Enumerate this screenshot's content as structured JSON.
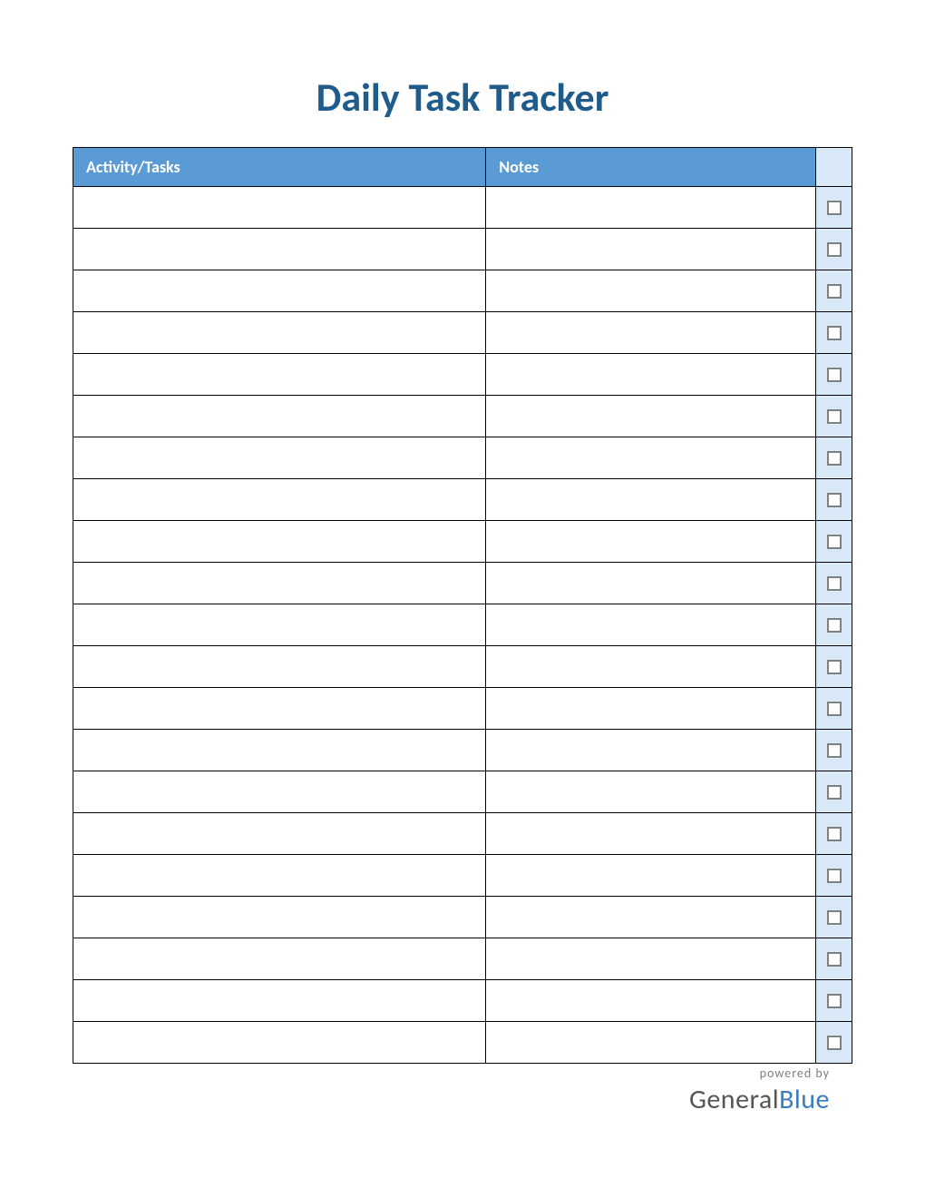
{
  "title": "Daily Task Tracker",
  "columns": {
    "activity": "Activity/Tasks",
    "notes": "Notes"
  },
  "rows": [
    {
      "activity": "",
      "notes": "",
      "checked": false
    },
    {
      "activity": "",
      "notes": "",
      "checked": false
    },
    {
      "activity": "",
      "notes": "",
      "checked": false
    },
    {
      "activity": "",
      "notes": "",
      "checked": false
    },
    {
      "activity": "",
      "notes": "",
      "checked": false
    },
    {
      "activity": "",
      "notes": "",
      "checked": false
    },
    {
      "activity": "",
      "notes": "",
      "checked": false
    },
    {
      "activity": "",
      "notes": "",
      "checked": false
    },
    {
      "activity": "",
      "notes": "",
      "checked": false
    },
    {
      "activity": "",
      "notes": "",
      "checked": false
    },
    {
      "activity": "",
      "notes": "",
      "checked": false
    },
    {
      "activity": "",
      "notes": "",
      "checked": false
    },
    {
      "activity": "",
      "notes": "",
      "checked": false
    },
    {
      "activity": "",
      "notes": "",
      "checked": false
    },
    {
      "activity": "",
      "notes": "",
      "checked": false
    },
    {
      "activity": "",
      "notes": "",
      "checked": false
    },
    {
      "activity": "",
      "notes": "",
      "checked": false
    },
    {
      "activity": "",
      "notes": "",
      "checked": false
    },
    {
      "activity": "",
      "notes": "",
      "checked": false
    },
    {
      "activity": "",
      "notes": "",
      "checked": false
    },
    {
      "activity": "",
      "notes": "",
      "checked": false
    }
  ],
  "footer": {
    "powered_by": "powered by",
    "brand_first": "General",
    "brand_second": "Blue"
  }
}
